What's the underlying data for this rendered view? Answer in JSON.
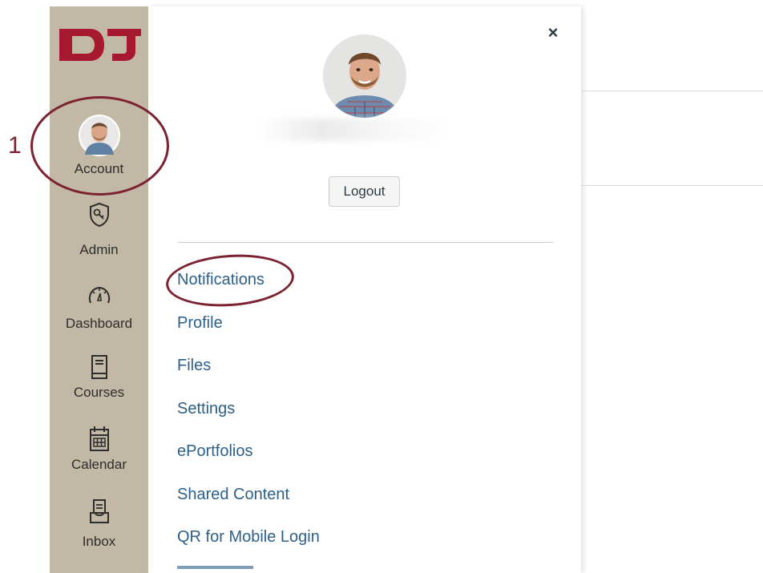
{
  "brand": {
    "logo_text": "DU",
    "primary_color": "#a6192e",
    "sidebar_color": "#c1b9a5",
    "annotation_color": "#7c2230",
    "link_color": "#2c5f8a"
  },
  "annotation": {
    "step_number": "1"
  },
  "global_nav": [
    {
      "label": "Account",
      "icon": "avatar"
    },
    {
      "label": "Admin",
      "icon": "shield-key-icon"
    },
    {
      "label": "Dashboard",
      "icon": "speedometer-icon"
    },
    {
      "label": "Courses",
      "icon": "book-icon"
    },
    {
      "label": "Calendar",
      "icon": "calendar-icon"
    },
    {
      "label": "Inbox",
      "icon": "inbox-icon"
    }
  ],
  "account_tray": {
    "close_symbol": "×",
    "logout_label": "Logout",
    "links": [
      "Notifications",
      "Profile",
      "Files",
      "Settings",
      "ePortfolios",
      "Shared Content",
      "QR for Mobile Login"
    ]
  }
}
